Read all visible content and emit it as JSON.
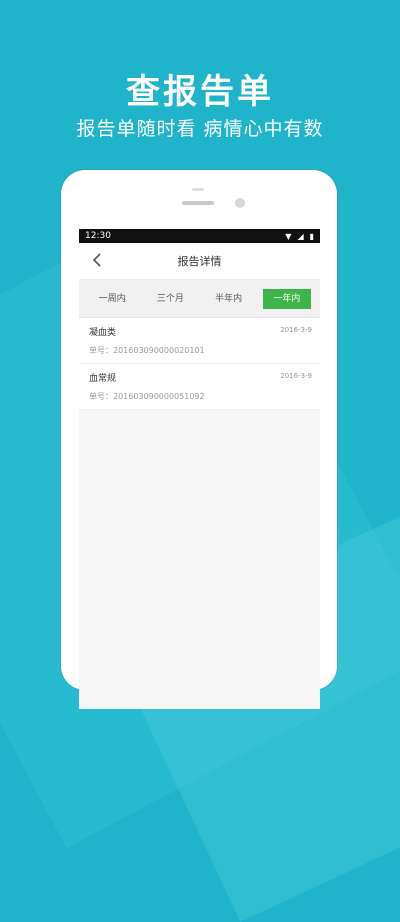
{
  "promo": {
    "headline": "查报告单",
    "subline": "报告单随时看 病情心中有数"
  },
  "statusbar": {
    "time": "12:30"
  },
  "navbar": {
    "title": "报告详情"
  },
  "tabs": [
    {
      "label": "一周内",
      "active": false
    },
    {
      "label": "三个月",
      "active": false
    },
    {
      "label": "半年内",
      "active": false
    },
    {
      "label": "一年内",
      "active": true
    }
  ],
  "reports": [
    {
      "title": "凝血类",
      "date": "2016-3-9",
      "number": "单号：201603090000020101"
    },
    {
      "title": "血常规",
      "date": "2016-3-9",
      "number": "单号：201603090000051092"
    }
  ],
  "colors": {
    "background": "#1fb4c9",
    "active_tab": "#3db54a"
  }
}
